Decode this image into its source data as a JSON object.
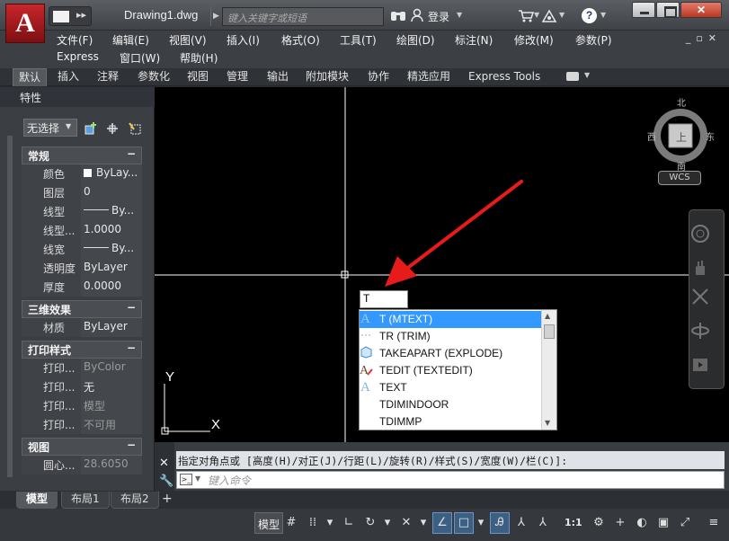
{
  "app": {
    "logo_letter": "A",
    "document_title": "Drawing1.dwg",
    "search_placeholder": "键入关键字或短语",
    "login_label": "登录",
    "icons": [
      "binoculars-icon",
      "user-icon",
      "cart-icon",
      "exchange-icon",
      "help-icon"
    ],
    "window_buttons": {
      "close": "✕"
    }
  },
  "menu": {
    "row1": [
      "文件(F)",
      "编辑(E)",
      "视图(V)",
      "插入(I)",
      "格式(O)",
      "工具(T)",
      "绘图(D)",
      "标注(N)",
      "修改(M)",
      "参数(P)"
    ],
    "row2": [
      "Express",
      "窗口(W)",
      "帮助(H)"
    ]
  },
  "ribbon": {
    "tabs": [
      "默认",
      "插入",
      "注释",
      "参数化",
      "视图",
      "管理",
      "输出",
      "附加模块",
      "协作",
      "精选应用",
      "Express Tools"
    ],
    "active_tab": "默认"
  },
  "palette": {
    "title": "特性",
    "selection": "无选择",
    "sections": [
      {
        "title": "常规",
        "rows": [
          {
            "name": "颜色",
            "value": "ByLay...",
            "kind": "color"
          },
          {
            "name": "图层",
            "value": "0"
          },
          {
            "name": "线型",
            "value": "By...",
            "kind": "linetype"
          },
          {
            "name": "线型...",
            "value": "1.0000"
          },
          {
            "name": "线宽",
            "value": "By...",
            "kind": "linetype"
          },
          {
            "name": "透明度",
            "value": "ByLayer"
          },
          {
            "name": "厚度",
            "value": "0.0000"
          }
        ]
      },
      {
        "title": "三维效果",
        "rows": [
          {
            "name": "材质",
            "value": "ByLayer"
          }
        ]
      },
      {
        "title": "打印样式",
        "rows": [
          {
            "name": "打印...",
            "value": "ByColor",
            "dim": true
          },
          {
            "name": "打印...",
            "value": "无"
          },
          {
            "name": "打印...",
            "value": "模型",
            "dim": true
          },
          {
            "name": "打印...",
            "value": "不可用",
            "dim": true
          }
        ]
      },
      {
        "title": "视图",
        "rows": [
          {
            "name": "圆心...",
            "value": "28.6050",
            "dim": true
          }
        ]
      }
    ],
    "collapse_symbol": "−"
  },
  "canvas": {
    "colors": {
      "background": "#000000",
      "crosshair": "#ffffff",
      "arrow": "#e81b1b"
    },
    "viewcube": {
      "north": "北",
      "south": "南",
      "east": "东",
      "west": "西",
      "face": "上",
      "ucs": "WCS"
    },
    "ucs_labels": {
      "x": "X",
      "y": "Y"
    },
    "dynamic_input": "T",
    "autocomplete": [
      {
        "label": "T (MTEXT)",
        "icon": "mtext-icon",
        "selected": true
      },
      {
        "label": "TR (TRIM)",
        "icon": "trim-icon"
      },
      {
        "label": "TAKEAPART (EXPLODE)",
        "icon": "explode-icon"
      },
      {
        "label": "TEDIT (TEXTEDIT)",
        "icon": "textedit-icon"
      },
      {
        "label": "TEXT",
        "icon": "text-icon"
      },
      {
        "label": "TDIMINDOOR",
        "icon": ""
      },
      {
        "label": "TDIMMP",
        "icon": ""
      }
    ]
  },
  "command": {
    "history": "指定对角点或 [高度(H)/对正(J)/行距(L)/旋转(R)/样式(S)/宽度(W)/栏(C)]:",
    "placeholder": "键入命令"
  },
  "layouts": {
    "tabs": [
      "模型",
      "布局1",
      "布局2"
    ],
    "active": "模型",
    "add": "+"
  },
  "status": {
    "model": "模型",
    "scale": "1:1"
  }
}
